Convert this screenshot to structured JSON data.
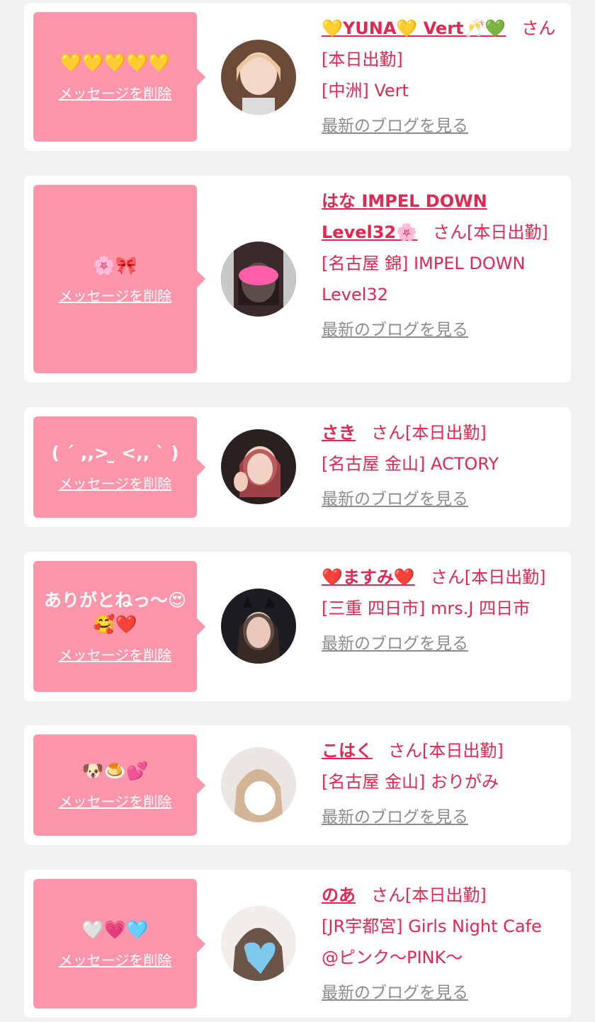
{
  "delete_label": "メッセージを削除",
  "blog_label": "最新のブログを見る",
  "san_suffix": "さん",
  "today_label": "[本日出勤]",
  "colors": {
    "bubble": "#ff95ab",
    "accent": "#e22852",
    "link_gray": "#8c8c8c"
  },
  "cards": [
    {
      "message": "💛💛💛💛💛",
      "name": "💛YUNA💛 Vert🥂💚",
      "area": "[中洲] Vert",
      "shop": ""
    },
    {
      "message": "🌸🎀",
      "name": "はな IMPEL DOWN Level32🌸",
      "area": "[名古屋 錦] IMPEL DOWN Level32",
      "shop": ""
    },
    {
      "message": "( ´ ,,>  ̫ <,, ` )",
      "name": "さき",
      "area": "[名古屋 金山] ACTORY",
      "shop": ""
    },
    {
      "message": "ありがとねっ〜😍🥰❤️",
      "name": "❤️ますみ❤️",
      "area": "[三重 四日市] mrs.J 四日市",
      "shop": ""
    },
    {
      "message": "🐶🍮💕",
      "name": "こはく",
      "area": "[名古屋 金山] おりがみ",
      "shop": ""
    },
    {
      "message": "🤍💗🩵",
      "name": "のあ",
      "area": "[JR宇都宮] Girls Night Cafe @ピンク〜PINK〜",
      "shop": ""
    }
  ]
}
